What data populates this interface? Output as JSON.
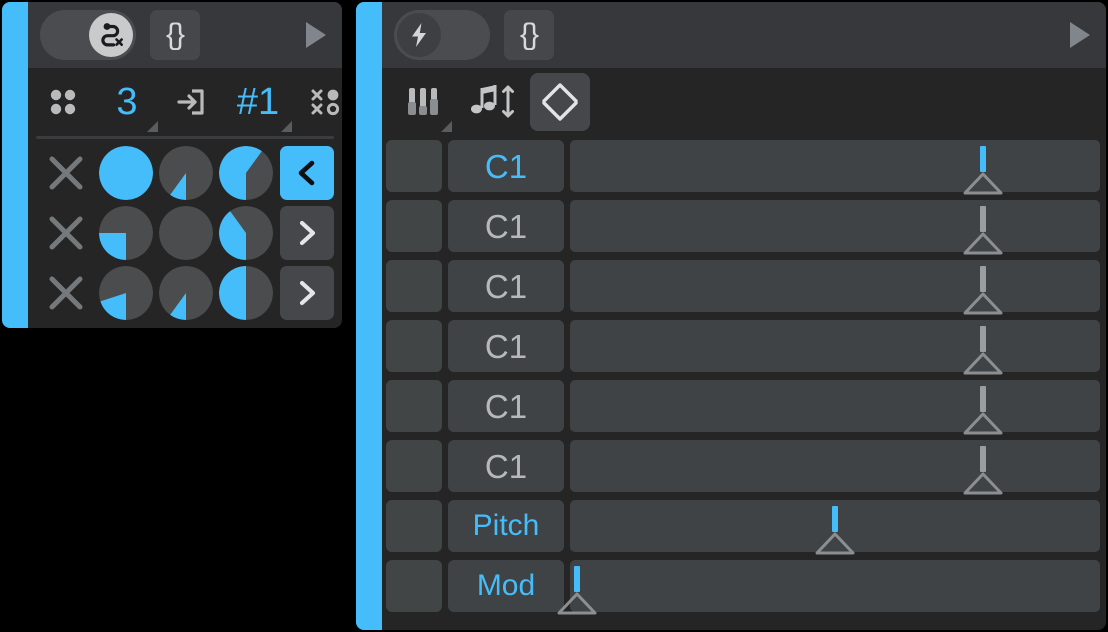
{
  "theme": {
    "accent": "#45bdfb",
    "page_background": "#000000",
    "panel_background": "#252525",
    "toolbar_background": "#37383c",
    "cell_background": "#3f4345",
    "label_gray": "#b6b8b9"
  },
  "left_panel": {
    "name": "modulation-matrix-panel",
    "toolbar": {
      "toggle": {
        "name": "route-toggle",
        "icon": "route-path-x-icon",
        "state": "on"
      },
      "braces_button": {
        "name": "braces-button",
        "label": "{}"
      },
      "play_button": {
        "name": "play-icon"
      }
    },
    "icon_row": [
      {
        "name": "four-dot-grid-icon",
        "type": "icon",
        "icon": "four-dot-grid-icon",
        "label": "",
        "has_corner_triangle": false
      },
      {
        "name": "count-value",
        "type": "value",
        "icon": "",
        "label": "3",
        "has_corner_triangle": true
      },
      {
        "name": "import-into-box-icon",
        "type": "icon",
        "icon": "arrow-into-box-icon",
        "label": "",
        "has_corner_triangle": false
      },
      {
        "name": "slot-number-value",
        "type": "value",
        "icon": "",
        "label": "#1",
        "has_corner_triangle": true
      },
      {
        "name": "randomize-icon",
        "type": "icon",
        "icon": "x-dot-scatter-icon",
        "label": "",
        "has_corner_triangle": true
      }
    ],
    "matrix_rows": [
      {
        "name": "matrix-row-1",
        "clear_label": "x",
        "pies": [
          {
            "name": "pie-amount-r1c1",
            "percent": 100
          },
          {
            "name": "pie-amount-r1c2",
            "percent": 10
          },
          {
            "name": "pie-amount-r1c3",
            "percent": 60
          }
        ],
        "nav": {
          "name": "collapse-button",
          "glyph": "<",
          "state": "active"
        }
      },
      {
        "name": "matrix-row-2",
        "clear_label": "x",
        "pies": [
          {
            "name": "pie-amount-r2c1",
            "percent": 25
          },
          {
            "name": "pie-amount-r2c2",
            "percent": 0
          },
          {
            "name": "pie-amount-r2c3",
            "percent": 40
          }
        ],
        "nav": {
          "name": "expand-button-row-2",
          "glyph": ">",
          "state": "idle"
        }
      },
      {
        "name": "matrix-row-3",
        "clear_label": "x",
        "pies": [
          {
            "name": "pie-amount-r3c1",
            "percent": 20
          },
          {
            "name": "pie-amount-r3c2",
            "percent": 10
          },
          {
            "name": "pie-amount-r3c3",
            "percent": 50
          }
        ],
        "nav": {
          "name": "expand-button-row-3",
          "glyph": ">",
          "state": "idle"
        }
      }
    ]
  },
  "right_panel": {
    "name": "midi-controller-panel",
    "toolbar": {
      "toggle": {
        "name": "power-toggle",
        "icon": "lightning-bolt-icon",
        "state": "off"
      },
      "braces_button": {
        "name": "braces-button",
        "label": "{}"
      },
      "play_button": {
        "name": "play-icon"
      }
    },
    "icon_row": [
      {
        "name": "faders-icon",
        "icon": "faders-icon",
        "has_corner_triangle": true,
        "state": "idle"
      },
      {
        "name": "note-transpose-icon",
        "icon": "music-note-updown-icon",
        "has_corner_triangle": false,
        "state": "idle"
      },
      {
        "name": "value-updown-button",
        "icon": "diamond-chevron-updown-icon",
        "has_corner_triangle": false,
        "state": "selected"
      }
    ],
    "rows": [
      {
        "name": "controller-row-1",
        "label": "C1",
        "label_accent": true,
        "value_percent": 78,
        "slider_accent": true
      },
      {
        "name": "controller-row-2",
        "label": "C1",
        "label_accent": false,
        "value_percent": 78,
        "slider_accent": false
      },
      {
        "name": "controller-row-3",
        "label": "C1",
        "label_accent": false,
        "value_percent": 78,
        "slider_accent": false
      },
      {
        "name": "controller-row-4",
        "label": "C1",
        "label_accent": false,
        "value_percent": 78,
        "slider_accent": false
      },
      {
        "name": "controller-row-5",
        "label": "C1",
        "label_accent": false,
        "value_percent": 78,
        "slider_accent": false
      },
      {
        "name": "controller-row-6",
        "label": "C1",
        "label_accent": false,
        "value_percent": 78,
        "slider_accent": false
      },
      {
        "name": "controller-row-pitch",
        "label": "Pitch",
        "label_accent": true,
        "value_percent": 50,
        "slider_accent": true
      },
      {
        "name": "controller-row-mod",
        "label": "Mod",
        "label_accent": true,
        "value_percent": 1,
        "slider_accent": true
      }
    ]
  }
}
